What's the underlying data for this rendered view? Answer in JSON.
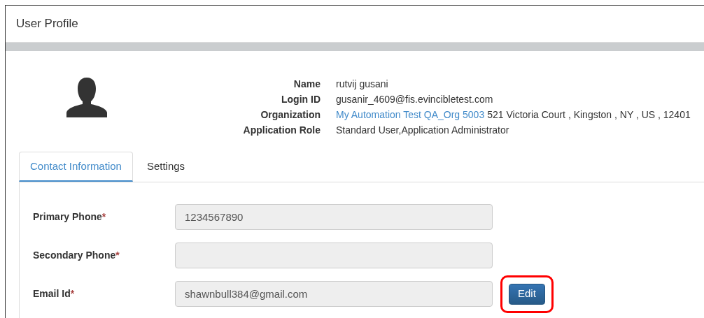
{
  "panel": {
    "title": "User Profile"
  },
  "profile": {
    "fields": [
      {
        "label": "Name",
        "value": "rutvij gusani"
      },
      {
        "label": "Login ID",
        "value": "gusanir_4609@fis.evincibletest.com"
      },
      {
        "label": "Organization",
        "link": "My Automation Test QA_Org 5003",
        "value": "521 Victoria Court , Kingston , NY , US , 12401"
      },
      {
        "label": "Application Role",
        "value": "Standard User,Application Administrator"
      }
    ]
  },
  "tabs": [
    {
      "label": "Contact Information",
      "selected": true
    },
    {
      "label": "Settings",
      "selected": false
    }
  ],
  "form": {
    "fields": [
      {
        "label": "Primary Phone",
        "required_mark": "*",
        "value": "1234567890",
        "disabled": true
      },
      {
        "label": "Secondary Phone",
        "required_mark": "*",
        "disabled": true
      },
      {
        "label": "Email Id",
        "required_mark": "*",
        "value": "shawnbull384@gmail.com",
        "disabled": true
      }
    ],
    "edit_button": {
      "label": "Edit",
      "highlighted": true
    }
  }
}
